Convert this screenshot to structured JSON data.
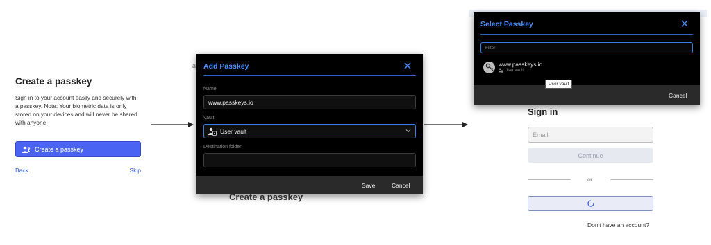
{
  "create_passkey": {
    "title": "Create a passkey",
    "description": "Sign in to your account easily and securely with a passkey. Note: Your biometric data is only stored on your devices and will never be shared with anyone.",
    "create_button": "Create a passkey",
    "back_link": "Back",
    "skip_link": "Skip"
  },
  "background_peek": {
    "fragment": "a",
    "title": "Create a passkey"
  },
  "add_passkey_dialog": {
    "title": "Add Passkey",
    "name_label": "Name",
    "name_value": "www.passkeys.io",
    "vault_label": "Vault",
    "vault_value": "User vault",
    "folder_label": "Destination folder",
    "folder_value": "",
    "save_button": "Save",
    "cancel_button": "Cancel"
  },
  "select_passkey_dialog": {
    "title": "Select Passkey",
    "filter_placeholder": "Filter",
    "item_name": "www.passkeys.io",
    "item_vault": "User vault",
    "tooltip": "User vault",
    "cancel_button": "Cancel"
  },
  "sign_in": {
    "title": "Sign in",
    "email_placeholder": "Email",
    "continue_button": "Continue",
    "or_text": "or",
    "no_account_link": "Don't have an account?"
  },
  "colors": {
    "accent_blue": "#4b63f2",
    "dialog_bg": "#000000",
    "dialog_title": "#4a90ff",
    "footer_bg": "#2a2a2a"
  }
}
